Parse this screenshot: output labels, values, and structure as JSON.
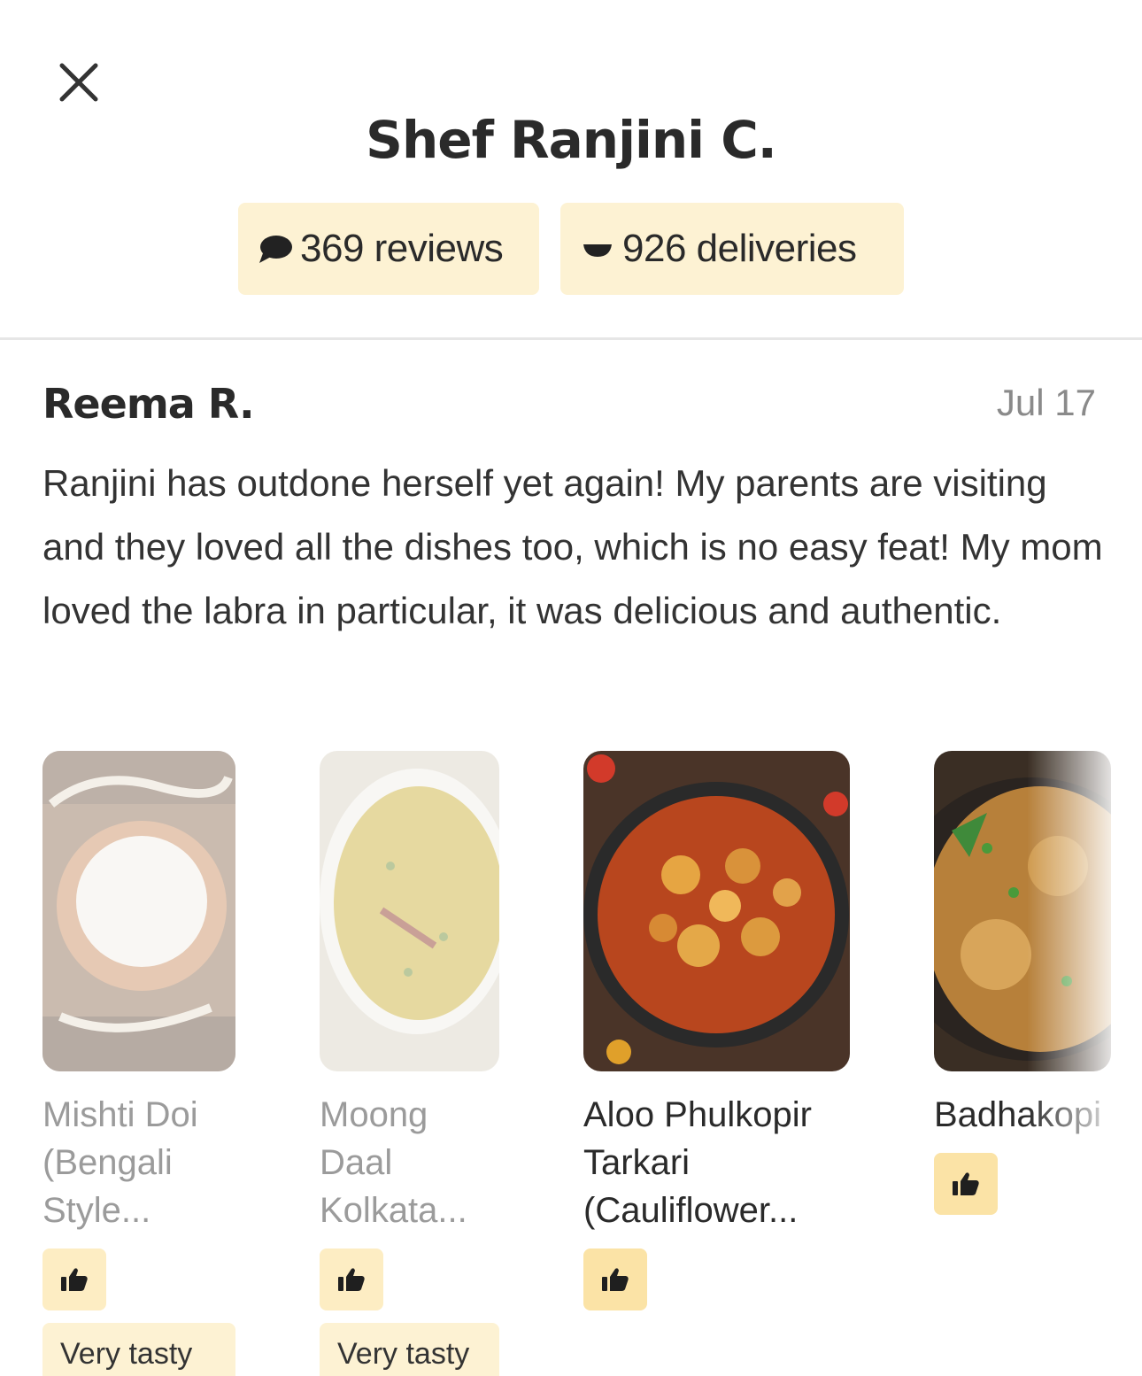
{
  "header": {
    "title": "Shef Ranjini C.",
    "close_icon": "close-icon"
  },
  "stats": {
    "reviews_label": "369 reviews",
    "reviews_icon": "speech-bubble-icon",
    "deliveries_label": "926 deliveries",
    "deliveries_icon": "delivery-icon"
  },
  "review": {
    "author": "Reema R.",
    "date": "Jul 17",
    "text": "Ranjini has outdone herself yet again! My parents are visiting and they loved all the dishes too, which is no easy feat! My mom loved the labra in particular, it was delicious and authentic."
  },
  "dishes": [
    {
      "name": "Mishti Doi (Bengali Style...",
      "tag": "Very tasty",
      "icon": "thumbs-up-icon"
    },
    {
      "name": "Moong Daal Kolkata...",
      "tag": "Very tasty",
      "icon": "thumbs-up-icon"
    },
    {
      "name": "Aloo Phulkopir Tarkari (Cauliflower...",
      "icon": "thumbs-up-icon"
    },
    {
      "name": "Badhakopi Ghonto (Bengali...",
      "icon": "thumbs-up-icon"
    }
  ],
  "colors": {
    "pill_background": "#fdf2d3",
    "thumb_background": "#fbe3a6",
    "text": "#2a2a2a",
    "muted": "#8a8a8a"
  }
}
